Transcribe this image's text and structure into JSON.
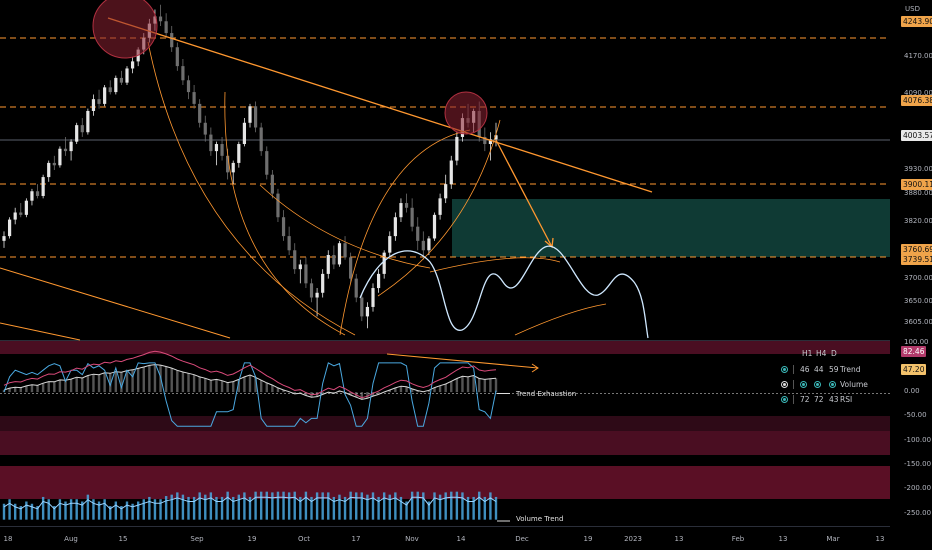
{
  "chart_data": {
    "type": "candlestick",
    "currency": "USD",
    "x_labels": [
      "18",
      "Aug",
      "15",
      "Sep",
      "19",
      "Oct",
      "17",
      "Nov",
      "14",
      "Dec",
      "19",
      "2023",
      "13",
      "Feb",
      "13",
      "Mar",
      "13"
    ],
    "price_axis_ticks": [
      "4170.00",
      "4090.00",
      "3930.00",
      "3880.00",
      "3820.00",
      "3700.00",
      "3650.00",
      "3605.00"
    ],
    "price_tags": [
      {
        "value": "4243.90",
        "style": "orange"
      },
      {
        "value": "4076.38",
        "style": "orange"
      },
      {
        "value": "4003.57",
        "style": "white"
      },
      {
        "value": "3900.11",
        "style": "orange"
      },
      {
        "value": "3760.69",
        "style": "orange"
      },
      {
        "value": "3739.51",
        "style": "orange"
      }
    ],
    "oscillator_axis_ticks": [
      "100.00",
      "50.00",
      "0.00",
      "-50.00",
      "-100.00",
      "-150.00",
      "-200.00",
      "-250.00"
    ],
    "oscillator_tags": [
      {
        "value": "82.46",
        "style": "pink"
      },
      {
        "value": "47.20",
        "style": "amber"
      }
    ],
    "price_range": [
      3570,
      4290
    ],
    "oscillator_range": [
      -275,
      105
    ],
    "candles": [
      [
        3780,
        3800,
        3765,
        3790
      ],
      [
        3790,
        3830,
        3785,
        3825
      ],
      [
        3825,
        3850,
        3815,
        3840
      ],
      [
        3840,
        3860,
        3830,
        3835
      ],
      [
        3835,
        3870,
        3830,
        3865
      ],
      [
        3865,
        3890,
        3855,
        3885
      ],
      [
        3885,
        3900,
        3870,
        3875
      ],
      [
        3875,
        3920,
        3870,
        3915
      ],
      [
        3915,
        3950,
        3905,
        3945
      ],
      [
        3945,
        3960,
        3930,
        3940
      ],
      [
        3940,
        3980,
        3935,
        3975
      ],
      [
        3975,
        4000,
        3960,
        3970
      ],
      [
        3970,
        3995,
        3950,
        3990
      ],
      [
        3990,
        4030,
        3985,
        4025
      ],
      [
        4025,
        4040,
        4000,
        4010
      ],
      [
        4010,
        4060,
        4005,
        4055
      ],
      [
        4055,
        4090,
        4045,
        4080
      ],
      [
        4080,
        4100,
        4060,
        4070
      ],
      [
        4070,
        4110,
        4065,
        4105
      ],
      [
        4105,
        4120,
        4090,
        4095
      ],
      [
        4095,
        4130,
        4090,
        4125
      ],
      [
        4125,
        4140,
        4110,
        4115
      ],
      [
        4115,
        4150,
        4110,
        4145
      ],
      [
        4145,
        4170,
        4135,
        4160
      ],
      [
        4160,
        4190,
        4150,
        4185
      ],
      [
        4185,
        4220,
        4175,
        4210
      ],
      [
        4210,
        4250,
        4200,
        4240
      ],
      [
        4240,
        4270,
        4225,
        4255
      ],
      [
        4255,
        4280,
        4235,
        4245
      ],
      [
        4245,
        4262,
        4210,
        4220
      ],
      [
        4220,
        4235,
        4180,
        4190
      ],
      [
        4190,
        4200,
        4140,
        4150
      ],
      [
        4150,
        4165,
        4110,
        4120
      ],
      [
        4120,
        4130,
        4080,
        4095
      ],
      [
        4095,
        4110,
        4060,
        4070
      ],
      [
        4070,
        4080,
        4020,
        4030
      ],
      [
        4030,
        4045,
        3990,
        4005
      ],
      [
        4005,
        4020,
        3960,
        3970
      ],
      [
        3970,
        3990,
        3940,
        3985
      ],
      [
        3985,
        4000,
        3950,
        3960
      ],
      [
        3960,
        3975,
        3910,
        3925
      ],
      [
        3925,
        3950,
        3900,
        3945
      ],
      [
        3945,
        3990,
        3935,
        3985
      ],
      [
        3985,
        4040,
        3980,
        4030
      ],
      [
        4030,
        4070,
        4020,
        4065
      ],
      [
        4065,
        4075,
        4010,
        4020
      ],
      [
        4020,
        4030,
        3960,
        3970
      ],
      [
        3970,
        3980,
        3910,
        3920
      ],
      [
        3920,
        3930,
        3870,
        3880
      ],
      [
        3880,
        3890,
        3820,
        3830
      ],
      [
        3830,
        3845,
        3780,
        3790
      ],
      [
        3790,
        3810,
        3750,
        3760
      ],
      [
        3760,
        3775,
        3710,
        3720
      ],
      [
        3720,
        3740,
        3690,
        3730
      ],
      [
        3730,
        3745,
        3680,
        3690
      ],
      [
        3690,
        3700,
        3650,
        3660
      ],
      [
        3660,
        3680,
        3620,
        3670
      ],
      [
        3670,
        3720,
        3660,
        3710
      ],
      [
        3710,
        3760,
        3700,
        3750
      ],
      [
        3750,
        3770,
        3720,
        3730
      ],
      [
        3730,
        3780,
        3725,
        3775
      ],
      [
        3775,
        3790,
        3740,
        3745
      ],
      [
        3745,
        3755,
        3690,
        3700
      ],
      [
        3700,
        3710,
        3650,
        3660
      ],
      [
        3660,
        3670,
        3610,
        3620
      ],
      [
        3620,
        3650,
        3595,
        3640
      ],
      [
        3640,
        3690,
        3630,
        3680
      ],
      [
        3680,
        3720,
        3670,
        3710
      ],
      [
        3710,
        3760,
        3700,
        3755
      ],
      [
        3755,
        3800,
        3745,
        3790
      ],
      [
        3790,
        3840,
        3780,
        3830
      ],
      [
        3830,
        3870,
        3820,
        3860
      ],
      [
        3860,
        3880,
        3840,
        3850
      ],
      [
        3850,
        3870,
        3800,
        3810
      ],
      [
        3810,
        3830,
        3760,
        3780
      ],
      [
        3780,
        3800,
        3740,
        3760
      ],
      [
        3760,
        3790,
        3750,
        3785
      ],
      [
        3785,
        3840,
        3780,
        3835
      ],
      [
        3835,
        3880,
        3825,
        3870
      ],
      [
        3870,
        3920,
        3860,
        3900
      ],
      [
        3900,
        3960,
        3890,
        3950
      ],
      [
        3950,
        4010,
        3940,
        4000
      ],
      [
        4000,
        4050,
        3990,
        4040
      ],
      [
        4040,
        4070,
        4020,
        4030
      ],
      [
        4030,
        4060,
        4010,
        4055
      ],
      [
        4055,
        4075,
        3990,
        4000
      ],
      [
        4000,
        4020,
        3970,
        3985
      ],
      [
        3985,
        4010,
        3950,
        3995
      ],
      [
        3995,
        4030,
        3980,
        4003.57
      ]
    ],
    "annotations": [
      {
        "text": "Trend Exhaustion",
        "panel": "oscillator"
      },
      {
        "text": "Volume Trend",
        "panel": "oscillator"
      }
    ]
  },
  "table": {
    "headers": [
      "H1",
      "H4",
      "D"
    ],
    "rows": [
      {
        "values": [
          "46",
          "44",
          "59"
        ],
        "label": "Trend"
      },
      {
        "values": [
          "",
          "",
          ""
        ],
        "label": "Volume"
      },
      {
        "values": [
          "72",
          "72",
          "43"
        ],
        "label": "RSI"
      }
    ]
  },
  "colors": {
    "up": "#e6e6e6",
    "down": "#6f6f6f",
    "level": "#ff9830",
    "trendline": "#ff9830",
    "zone": "#0f3a34",
    "projection": "#cfe8ff",
    "circle": "#8b2032",
    "oscillator_band": "#5a1128"
  }
}
